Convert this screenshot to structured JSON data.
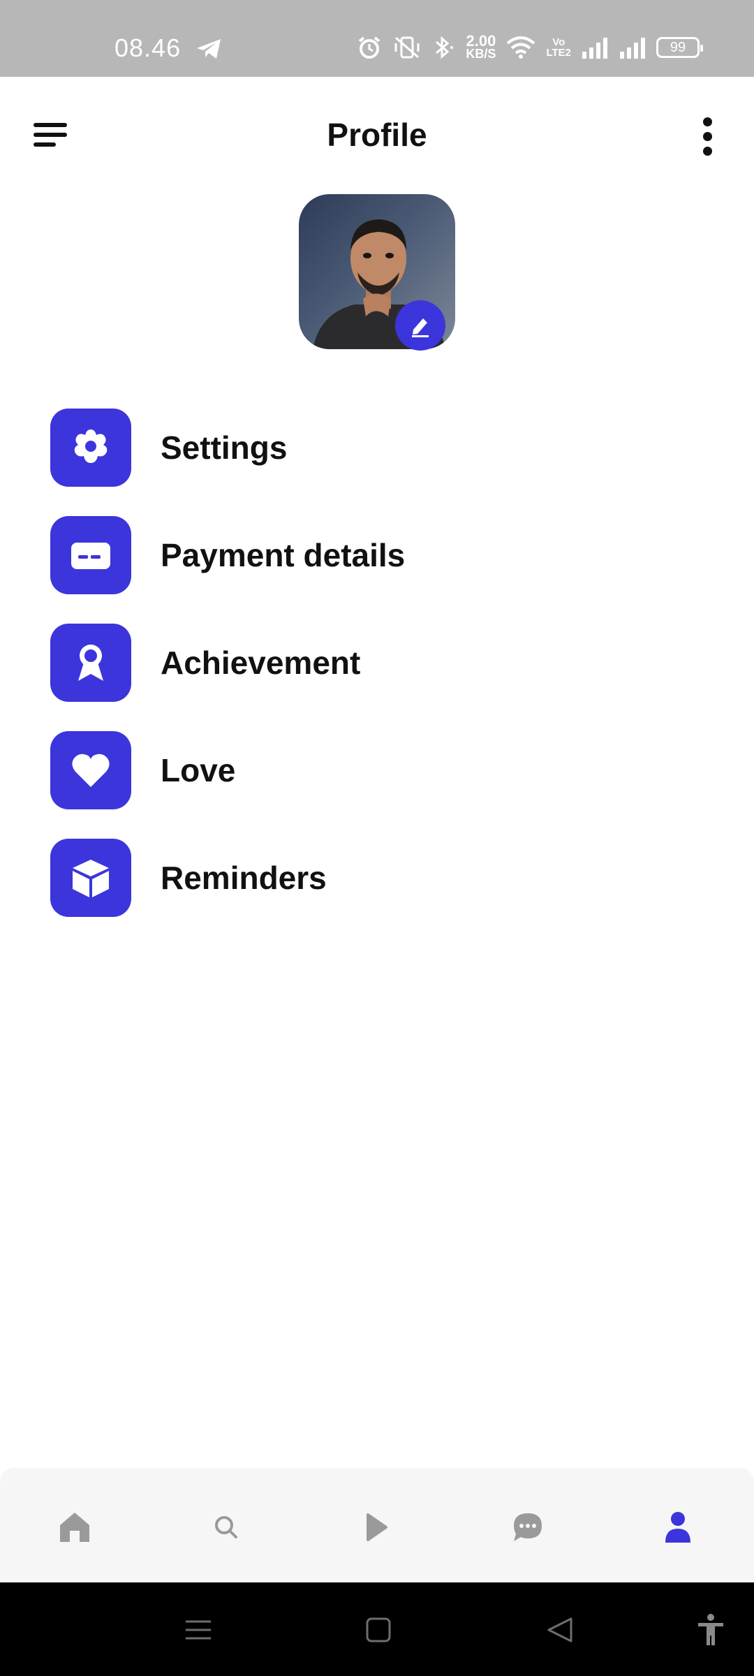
{
  "status_bar": {
    "time": "08.46",
    "net_speed_value": "2.00",
    "net_speed_unit": "KB/S",
    "volte_top": "Vo",
    "volte_bottom": "LTE2",
    "battery": "99",
    "icons": [
      "telegram-icon",
      "alarm-icon",
      "vibrate-icon",
      "bluetooth-icon",
      "wifi-icon",
      "signal-icon"
    ]
  },
  "header": {
    "title": "Profile"
  },
  "menu": {
    "items": [
      {
        "label": "Settings",
        "icon": "settings-icon"
      },
      {
        "label": "Payment details",
        "icon": "card-icon"
      },
      {
        "label": "Achievement",
        "icon": "award-icon"
      },
      {
        "label": "Love",
        "icon": "heart-icon"
      },
      {
        "label": "Reminders",
        "icon": "box-icon"
      }
    ]
  },
  "bottom_nav": {
    "items": [
      "home-icon",
      "search-icon",
      "play-icon",
      "chat-icon",
      "profile-icon"
    ],
    "active": "profile-icon",
    "active_color": "#3b35db",
    "inactive_color": "#9a9a9a"
  },
  "colors": {
    "accent": "#3b35db",
    "status_bar": "#b7b7b7"
  }
}
